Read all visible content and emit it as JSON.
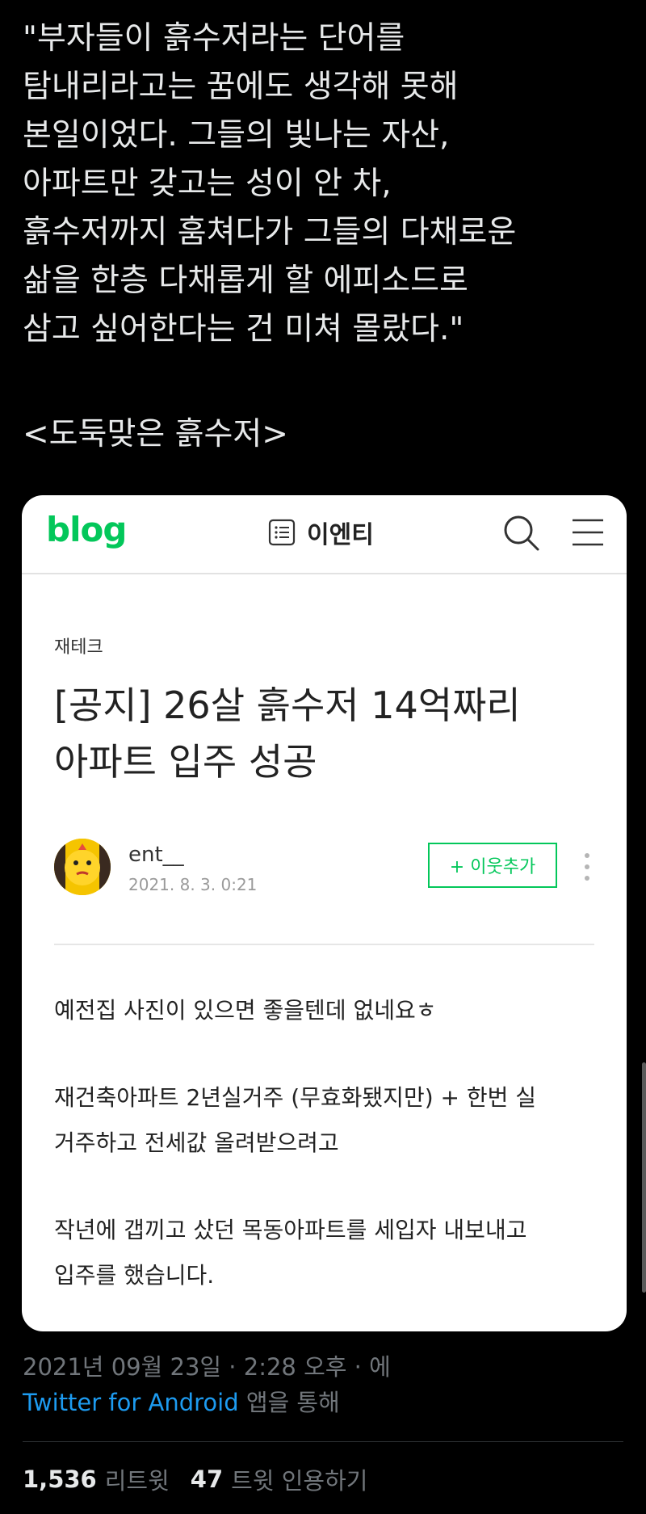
{
  "tweet": {
    "lines": [
      "\"부자들이 흙수저라는 단어를",
      "탐내리라고는 꿈에도 생각해 못해",
      "본일이었다. 그들의 빛나는 자산,",
      "아파트만 갖고는 성이 안 차,",
      "흙수저까지 훔쳐다가 그들의 다채로운",
      "삶을 한층 다채롭게 할 에피소드로",
      "삼고 싶어한다는 건 미쳐 몰랐다.\""
    ],
    "caption": "<도둑맞은 흙수저>"
  },
  "card": {
    "logo": "blog",
    "blog_name": "이엔티",
    "category": "재테크",
    "title_lines": [
      "[공지] 26살 흙수저 14억짜리",
      "아파트 입주 성공"
    ],
    "author": "ent__",
    "date": "2021. 8. 3. 0:21",
    "follow_label": "+ 이웃추가",
    "body": [
      [
        "예전집 사진이 있으면 좋을텐데 없네요ㅎ"
      ],
      [
        "재건축아파트 2년실거주 (무효화됐지만) + 한번 실",
        "거주하고 전세값 올려받으려고"
      ],
      [
        "작년에 갭끼고 샀던 목동아파트를 세입자 내보내고",
        "입주를 했습니다."
      ]
    ],
    "accent_color": "#03c75a"
  },
  "meta": {
    "timestamp": "2021년 09월 23일 · 2:28 오후 · 에",
    "source_app": "Twitter for Android",
    "source_suffix": " 앱을 통해"
  },
  "stats": {
    "retweets_count": "1,536",
    "retweets_label": "리트윗",
    "quotes_count": "47",
    "quotes_label": "트윗 인용하기"
  }
}
